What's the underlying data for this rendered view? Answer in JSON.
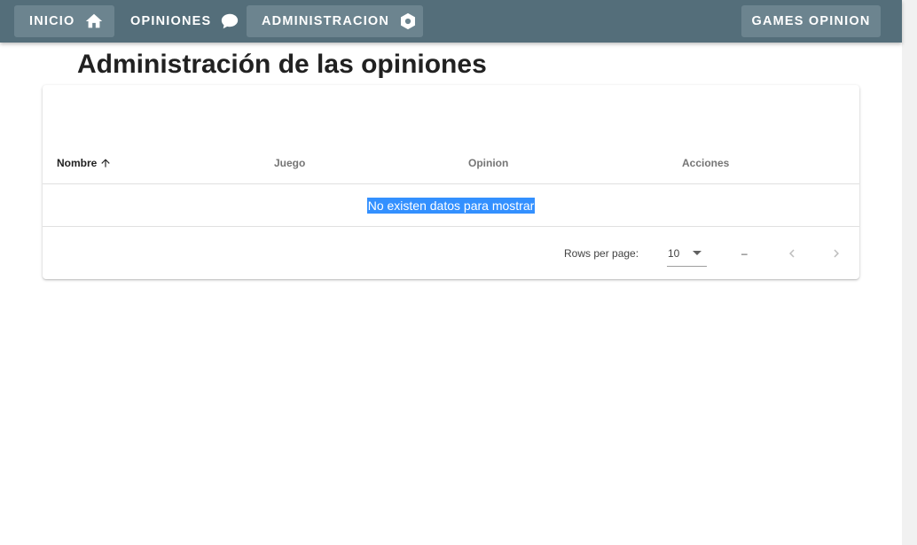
{
  "navbar": {
    "items": [
      {
        "label": "INICIO",
        "icon": "home-icon"
      },
      {
        "label": "OPINIONES",
        "icon": "comment-icon"
      },
      {
        "label": "ADMINISTRACION",
        "icon": "hexagon-icon"
      }
    ],
    "brand_label": "GAMES OPINION",
    "color": "#546e7a"
  },
  "page": {
    "title": "Administración de las opiniones"
  },
  "table": {
    "columns": [
      {
        "label": "Nombre",
        "sorted": "ascending"
      },
      {
        "label": "Juego"
      },
      {
        "label": "Opinion"
      },
      {
        "label": "Acciones"
      }
    ],
    "empty_message": "No existen datos para mostrar"
  },
  "pagination": {
    "rows_per_page_label": "Rows per page:",
    "rows_per_page_value": "10",
    "range_text": "–"
  }
}
